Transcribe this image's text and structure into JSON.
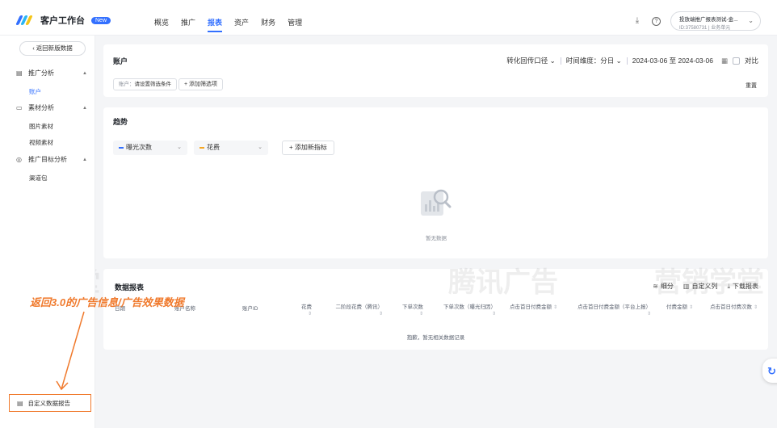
{
  "header": {
    "app_title": "客户工作台",
    "new_badge": "New",
    "nav": [
      "概览",
      "推广",
      "报表",
      "资产",
      "财务",
      "管理"
    ],
    "active_nav": "报表",
    "account_name": "投放端推广报表测试-金...",
    "account_id": "ID:37580731",
    "account_type": "业务单元"
  },
  "watermarks": {
    "brand": "腾讯广告",
    "school": "营销学堂"
  },
  "sidebar": {
    "back_label": "返回新版数据",
    "groups": [
      {
        "label": "推广分析",
        "subs": [
          "账户"
        ]
      },
      {
        "label": "素材分析",
        "subs": [
          "图片素材",
          "视频素材"
        ]
      },
      {
        "label": "推广目标分析",
        "subs": [
          "渠道包"
        ]
      }
    ],
    "active_sub": "账户",
    "custom_report": "自定义数据报告"
  },
  "filter_card": {
    "title": "账户",
    "conversion_caliber": "转化回传口径",
    "time_dim_label": "时间维度：",
    "time_dim_value": "分日",
    "date_range": "2024-03-06 至 2024-03-06",
    "compare": "对比",
    "chip_label": "账户：",
    "chip_value": "请设置筛选条件",
    "add_filter": "+ 添加筛选项",
    "reset": "重置"
  },
  "trend_card": {
    "title": "趋势",
    "metric1": "曝光次数",
    "metric2": "花费",
    "add_metric": "+ 添加新指标",
    "empty": "暂无数据",
    "colors": {
      "metric1": "#3370ff",
      "metric2": "#f5a623"
    }
  },
  "table_card": {
    "title": "数据报表",
    "breakdown": "细分",
    "custom_columns": "自定义列",
    "download": "下载报表",
    "columns": [
      "日期",
      "账户名称",
      "账户ID",
      "花费",
      "二阶段花费（腾讯）",
      "下单次数",
      "下单次数（曝光归因）",
      "点击首日付费金额",
      "点击首日付费金额（平台上报）",
      "付费金额",
      "点击首日付费次数"
    ],
    "empty": "抱歉，暂无相关数据记录"
  },
  "annotation": "返回3.0的广告信息/广告效果数据",
  "annotation_color": "#f07a2d"
}
